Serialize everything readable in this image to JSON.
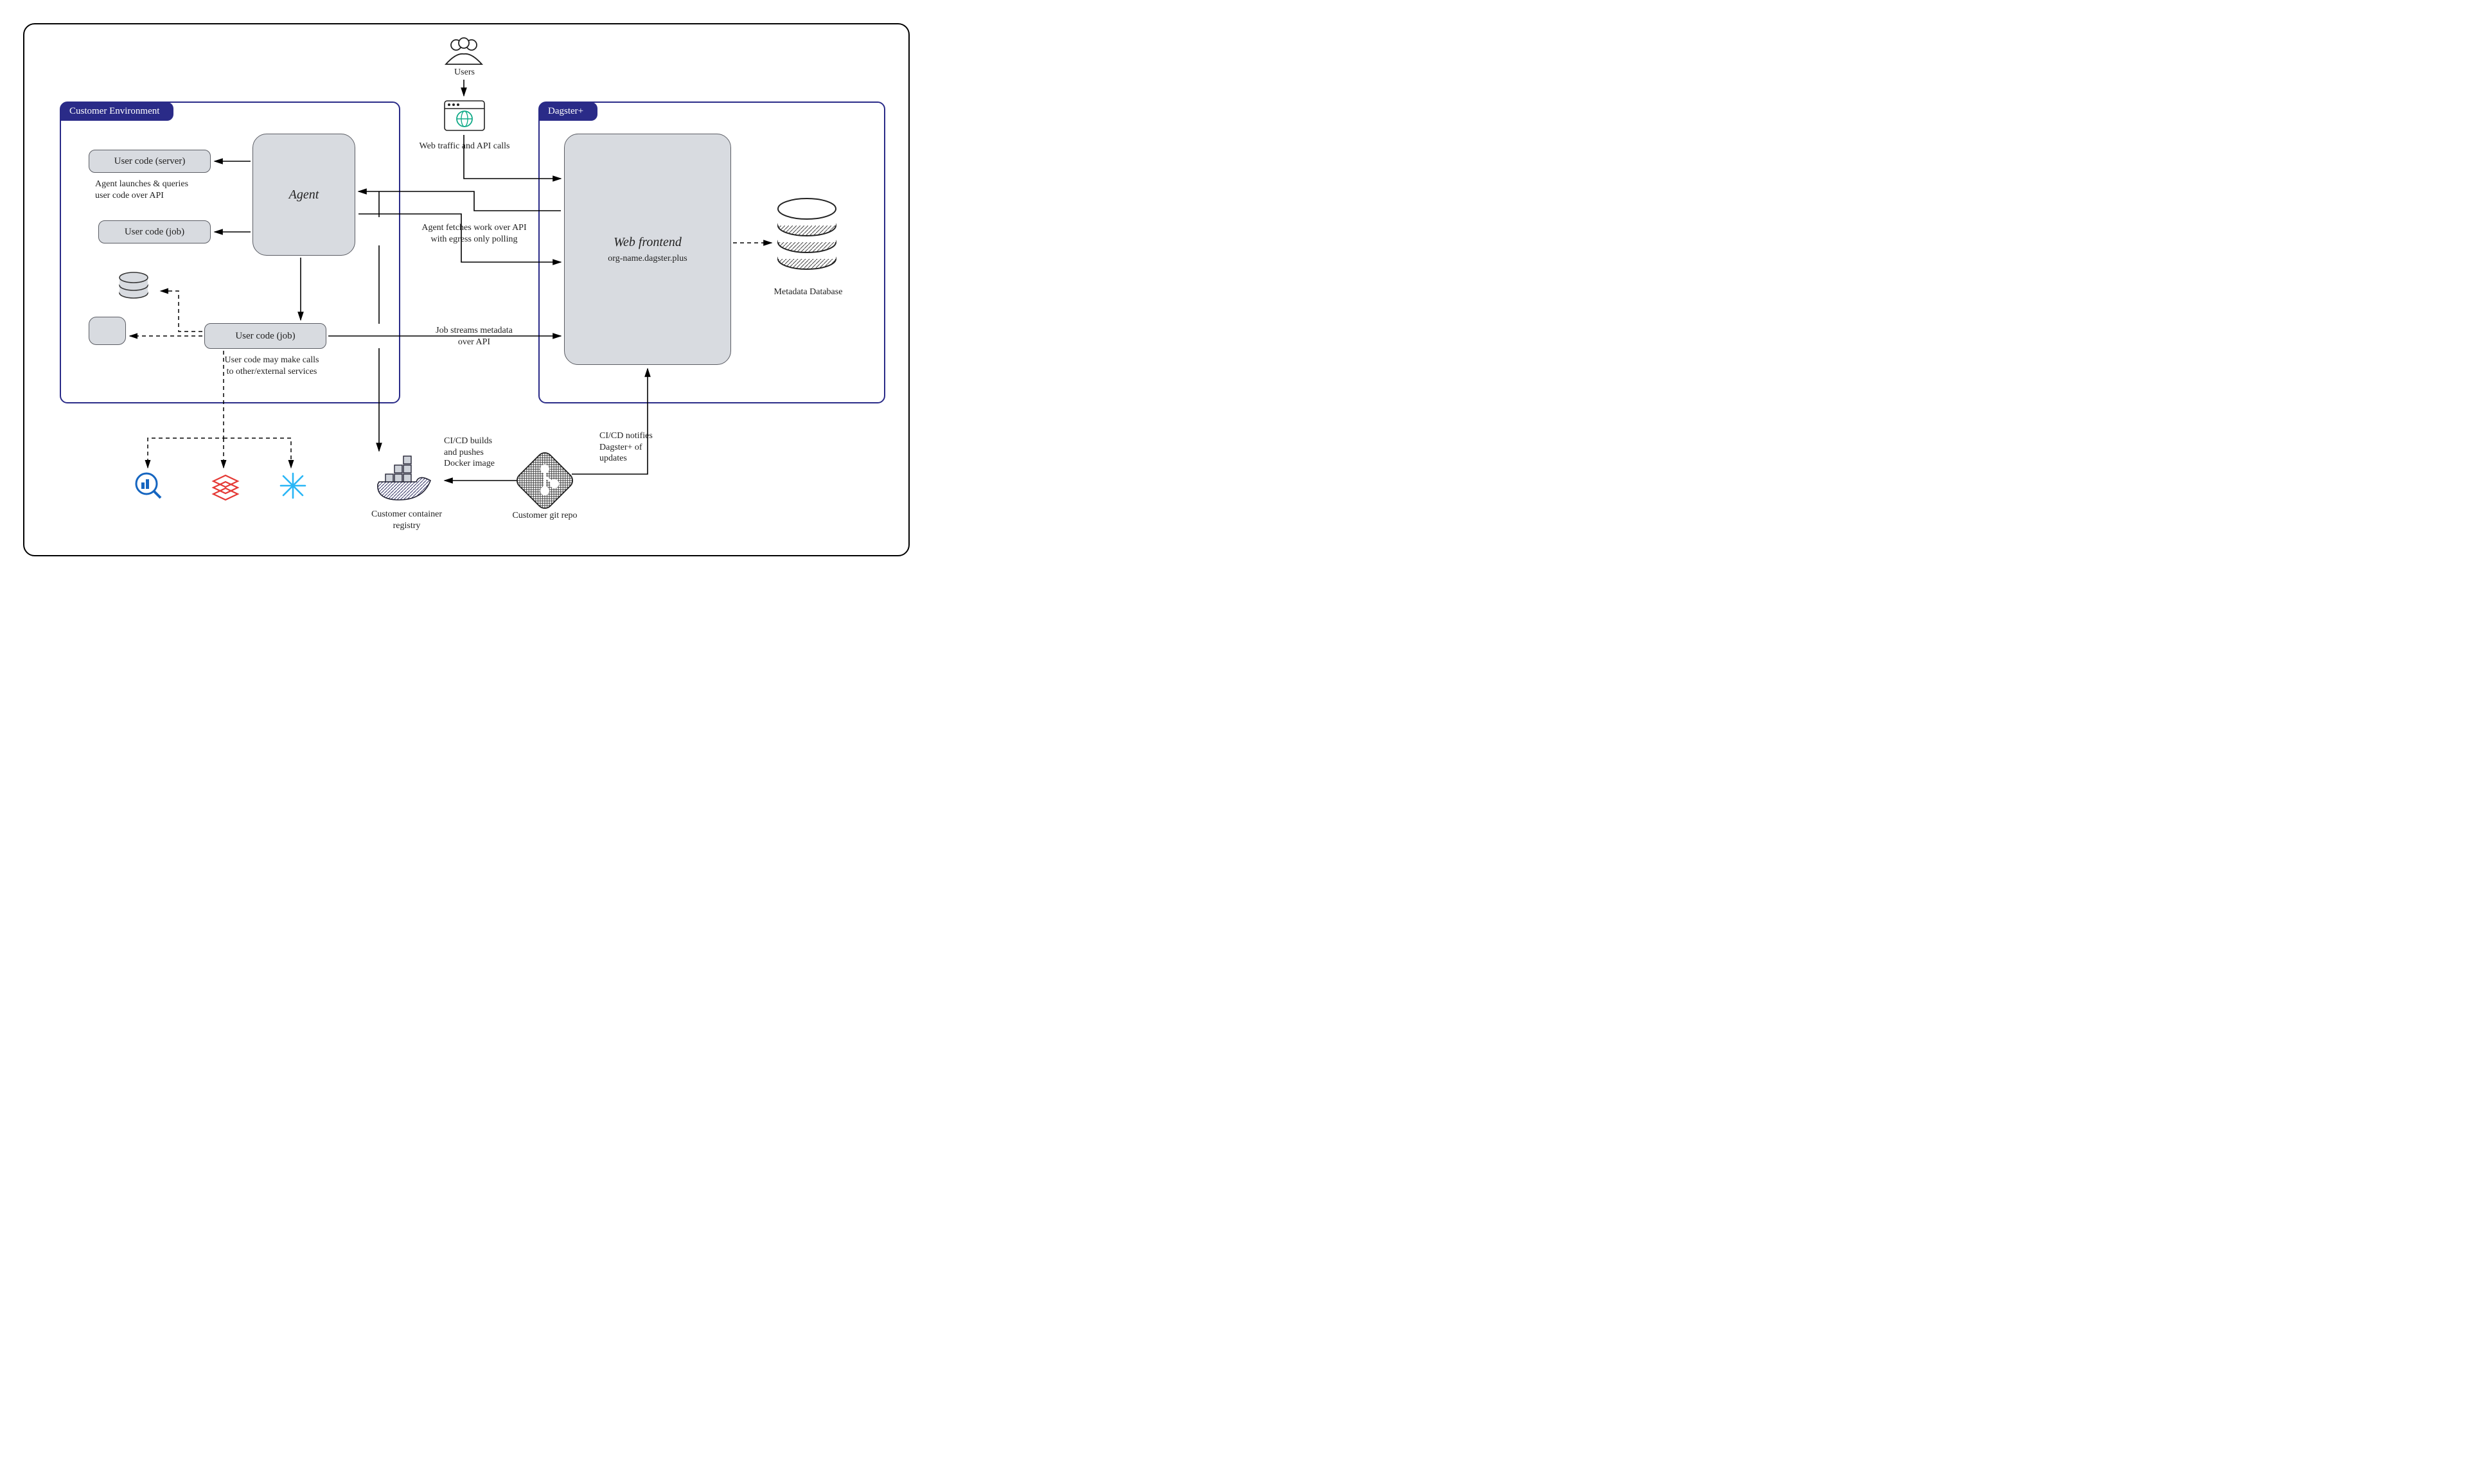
{
  "zones": {
    "customer": "Customer Environment",
    "dagster": "Dagster+"
  },
  "boxes": {
    "agent": "Agent",
    "user_code_server": "User code (server)",
    "user_code_job1": "User code (job)",
    "user_code_job2": "User code (job)",
    "web_frontend_title": "Web frontend",
    "web_frontend_sub": "org-name.dagster.plus"
  },
  "labels": {
    "users": "Users",
    "web_traffic": "Web traffic and API calls",
    "agent_launches": "Agent launches & queries\nuser code over API",
    "agent_fetches": "Agent fetches work over API\nwith egress only polling",
    "job_streams": "Job streams metadata\nover API",
    "user_code_calls": "User code may make calls\nto other/external services",
    "metadata_db": "Metadata Database",
    "cicd_builds": "CI/CD builds\nand pushes\nDocker image",
    "cicd_notifies": "CI/CD notifies\nDagster+ of\nupdates",
    "container_registry": "Customer container\nregistry",
    "git_repo": "Customer git repo"
  },
  "icons": {
    "users": "users-icon",
    "browser": "browser-icon",
    "db_small": "database-icon",
    "db_metadata": "database-icon",
    "service_box": "service-icon",
    "bigquery": "bigquery-icon",
    "databricks": "databricks-icon",
    "snowflake": "snowflake-icon",
    "docker": "docker-icon",
    "git": "git-icon"
  }
}
